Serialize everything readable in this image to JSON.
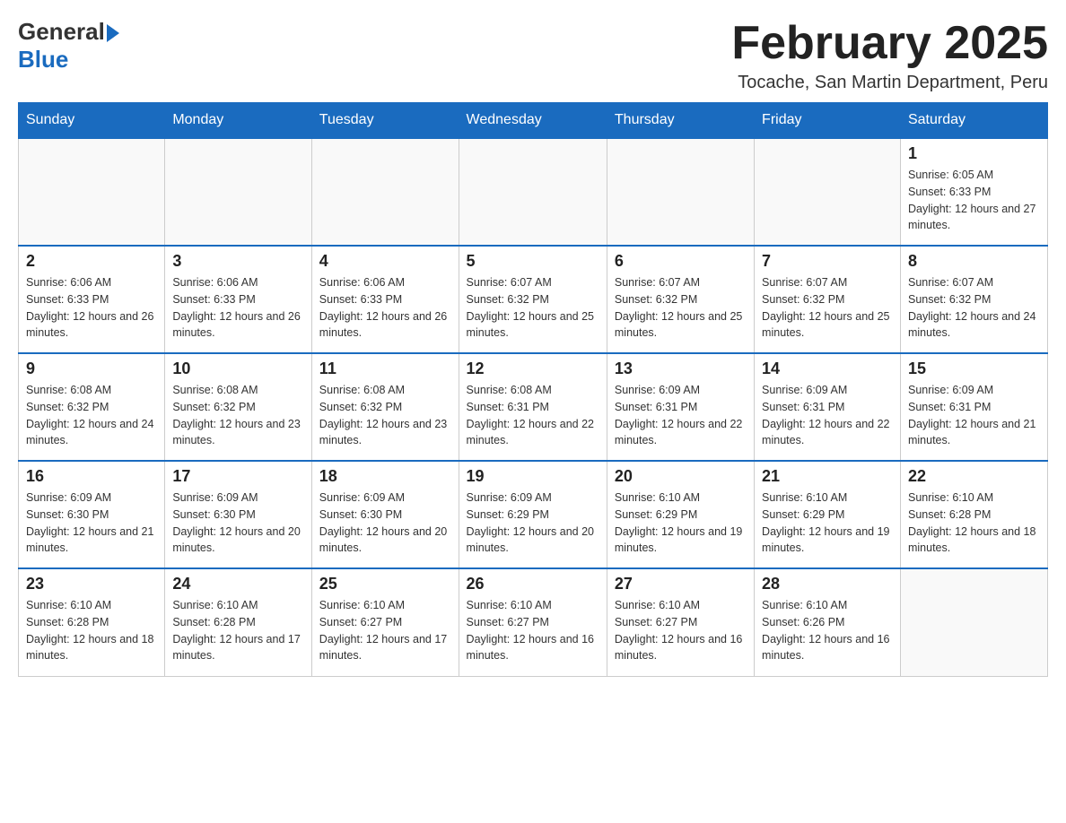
{
  "header": {
    "logo_general": "General",
    "logo_blue": "Blue",
    "month_title": "February 2025",
    "location": "Tocache, San Martin Department, Peru"
  },
  "days_of_week": [
    "Sunday",
    "Monday",
    "Tuesday",
    "Wednesday",
    "Thursday",
    "Friday",
    "Saturday"
  ],
  "weeks": [
    [
      {
        "day": "",
        "info": ""
      },
      {
        "day": "",
        "info": ""
      },
      {
        "day": "",
        "info": ""
      },
      {
        "day": "",
        "info": ""
      },
      {
        "day": "",
        "info": ""
      },
      {
        "day": "",
        "info": ""
      },
      {
        "day": "1",
        "info": "Sunrise: 6:05 AM\nSunset: 6:33 PM\nDaylight: 12 hours and 27 minutes."
      }
    ],
    [
      {
        "day": "2",
        "info": "Sunrise: 6:06 AM\nSunset: 6:33 PM\nDaylight: 12 hours and 26 minutes."
      },
      {
        "day": "3",
        "info": "Sunrise: 6:06 AM\nSunset: 6:33 PM\nDaylight: 12 hours and 26 minutes."
      },
      {
        "day": "4",
        "info": "Sunrise: 6:06 AM\nSunset: 6:33 PM\nDaylight: 12 hours and 26 minutes."
      },
      {
        "day": "5",
        "info": "Sunrise: 6:07 AM\nSunset: 6:32 PM\nDaylight: 12 hours and 25 minutes."
      },
      {
        "day": "6",
        "info": "Sunrise: 6:07 AM\nSunset: 6:32 PM\nDaylight: 12 hours and 25 minutes."
      },
      {
        "day": "7",
        "info": "Sunrise: 6:07 AM\nSunset: 6:32 PM\nDaylight: 12 hours and 25 minutes."
      },
      {
        "day": "8",
        "info": "Sunrise: 6:07 AM\nSunset: 6:32 PM\nDaylight: 12 hours and 24 minutes."
      }
    ],
    [
      {
        "day": "9",
        "info": "Sunrise: 6:08 AM\nSunset: 6:32 PM\nDaylight: 12 hours and 24 minutes."
      },
      {
        "day": "10",
        "info": "Sunrise: 6:08 AM\nSunset: 6:32 PM\nDaylight: 12 hours and 23 minutes."
      },
      {
        "day": "11",
        "info": "Sunrise: 6:08 AM\nSunset: 6:32 PM\nDaylight: 12 hours and 23 minutes."
      },
      {
        "day": "12",
        "info": "Sunrise: 6:08 AM\nSunset: 6:31 PM\nDaylight: 12 hours and 22 minutes."
      },
      {
        "day": "13",
        "info": "Sunrise: 6:09 AM\nSunset: 6:31 PM\nDaylight: 12 hours and 22 minutes."
      },
      {
        "day": "14",
        "info": "Sunrise: 6:09 AM\nSunset: 6:31 PM\nDaylight: 12 hours and 22 minutes."
      },
      {
        "day": "15",
        "info": "Sunrise: 6:09 AM\nSunset: 6:31 PM\nDaylight: 12 hours and 21 minutes."
      }
    ],
    [
      {
        "day": "16",
        "info": "Sunrise: 6:09 AM\nSunset: 6:30 PM\nDaylight: 12 hours and 21 minutes."
      },
      {
        "day": "17",
        "info": "Sunrise: 6:09 AM\nSunset: 6:30 PM\nDaylight: 12 hours and 20 minutes."
      },
      {
        "day": "18",
        "info": "Sunrise: 6:09 AM\nSunset: 6:30 PM\nDaylight: 12 hours and 20 minutes."
      },
      {
        "day": "19",
        "info": "Sunrise: 6:09 AM\nSunset: 6:29 PM\nDaylight: 12 hours and 20 minutes."
      },
      {
        "day": "20",
        "info": "Sunrise: 6:10 AM\nSunset: 6:29 PM\nDaylight: 12 hours and 19 minutes."
      },
      {
        "day": "21",
        "info": "Sunrise: 6:10 AM\nSunset: 6:29 PM\nDaylight: 12 hours and 19 minutes."
      },
      {
        "day": "22",
        "info": "Sunrise: 6:10 AM\nSunset: 6:28 PM\nDaylight: 12 hours and 18 minutes."
      }
    ],
    [
      {
        "day": "23",
        "info": "Sunrise: 6:10 AM\nSunset: 6:28 PM\nDaylight: 12 hours and 18 minutes."
      },
      {
        "day": "24",
        "info": "Sunrise: 6:10 AM\nSunset: 6:28 PM\nDaylight: 12 hours and 17 minutes."
      },
      {
        "day": "25",
        "info": "Sunrise: 6:10 AM\nSunset: 6:27 PM\nDaylight: 12 hours and 17 minutes."
      },
      {
        "day": "26",
        "info": "Sunrise: 6:10 AM\nSunset: 6:27 PM\nDaylight: 12 hours and 16 minutes."
      },
      {
        "day": "27",
        "info": "Sunrise: 6:10 AM\nSunset: 6:27 PM\nDaylight: 12 hours and 16 minutes."
      },
      {
        "day": "28",
        "info": "Sunrise: 6:10 AM\nSunset: 6:26 PM\nDaylight: 12 hours and 16 minutes."
      },
      {
        "day": "",
        "info": ""
      }
    ]
  ]
}
